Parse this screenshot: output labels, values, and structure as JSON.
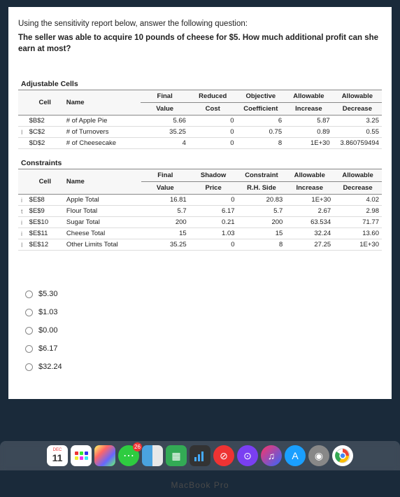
{
  "intro": "Using the sensitivity report below, answer the following question:",
  "question_prefix": "The seller was able to acquire 10 pounds of cheese for $5. How much additional profit can she earn ",
  "question_suffix": "at most?",
  "adjustable": {
    "title": "Adjustable Cells",
    "headers": {
      "cell": "Cell",
      "name": "Name",
      "final_top": "Final",
      "final_bot": "Value",
      "reduced_top": "Reduced",
      "reduced_bot": "Cost",
      "obj_top": "Objective",
      "obj_bot": "Coefficient",
      "inc_top": "Allowable",
      "inc_bot": "Increase",
      "dec_top": "Allowable",
      "dec_bot": "Decrease"
    },
    "rows": [
      {
        "marker": "",
        "cell": "$B$2",
        "name": "# of Apple Pie",
        "final": "5.66",
        "reduced": "0",
        "obj": "6",
        "inc": "5.87",
        "dec": "3.25"
      },
      {
        "marker": "I",
        "cell": "$C$2",
        "name": "# of Turnovers",
        "final": "35.25",
        "reduced": "0",
        "obj": "0.75",
        "inc": "0.89",
        "dec": "0.55"
      },
      {
        "marker": "",
        "cell": "$D$2",
        "name": "# of Cheesecake",
        "final": "4",
        "reduced": "0",
        "obj": "8",
        "inc": "1E+30",
        "dec": "3.860759494"
      }
    ]
  },
  "constraints": {
    "title": "Constraints",
    "headers": {
      "cell": "Cell",
      "name": "Name",
      "final_top": "Final",
      "final_bot": "Value",
      "shadow_top": "Shadow",
      "shadow_bot": "Price",
      "con_top": "Constraint",
      "con_bot": "R.H. Side",
      "inc_top": "Allowable",
      "inc_bot": "Increase",
      "dec_top": "Allowable",
      "dec_bot": "Decrease"
    },
    "rows": [
      {
        "marker": "i",
        "cell": "$E$8",
        "name": "Apple Total",
        "final": "16.81",
        "shadow": "0",
        "con": "20.83",
        "inc": "1E+30",
        "dec": "4.02"
      },
      {
        "marker": "t",
        "cell": "$E$9",
        "name": "Flour Total",
        "final": "5.7",
        "shadow": "6.17",
        "con": "5.7",
        "inc": "2.67",
        "dec": "2.98"
      },
      {
        "marker": "i",
        "cell": "$E$10",
        "name": "Sugar Total",
        "final": "200",
        "shadow": "0.21",
        "con": "200",
        "inc": "63.534",
        "dec": "71.77"
      },
      {
        "marker": "i",
        "cell": "$E$11",
        "name": "Cheese Total",
        "final": "15",
        "shadow": "1.03",
        "con": "15",
        "inc": "32.24",
        "dec": "13.60"
      },
      {
        "marker": "I",
        "cell": "$E$12",
        "name": "Other Limits Total",
        "final": "35.25",
        "shadow": "0",
        "con": "8",
        "inc": "27.25",
        "dec": "1E+30"
      }
    ]
  },
  "options": [
    "$5.30",
    "$1.03",
    "$0.00",
    "$6.17",
    "$32.24"
  ],
  "calendar_day": "11",
  "messages_badge": "26",
  "macbook": "MacBook Pro"
}
